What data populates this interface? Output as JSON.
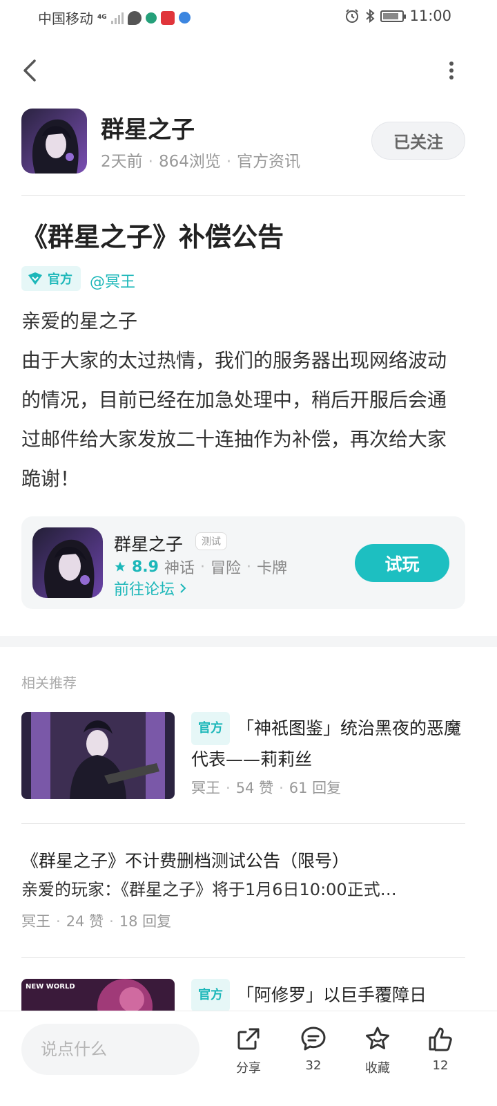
{
  "status_bar": {
    "carrier": "中国移动",
    "network": "4G",
    "time": "11:00"
  },
  "author": {
    "name": "群星之子",
    "time": "2天前",
    "views": "864浏览",
    "category": "官方资讯",
    "follow_label": "已关注"
  },
  "post": {
    "title": "《群星之子》补偿公告",
    "official_tag": "官方",
    "mention": "@冥王",
    "greeting": "亲爱的星之子",
    "body": "由于大家的太过热情，我们的服务器出现网络波动的情况，目前已经在加急处理中，稍后开服后会通过邮件给大家发放二十连抽作为补偿，再次给大家跪谢！"
  },
  "game_card": {
    "name": "群星之子",
    "badge": "测试",
    "score": "8.9",
    "tags": [
      "神话",
      "冒险",
      "卡牌"
    ],
    "forum_link": "前往论坛",
    "play_label": "试玩"
  },
  "related": {
    "section_title": "相关推荐",
    "items": [
      {
        "tag": "官方",
        "title": "「神祇图鉴」统治黑夜的恶魔代表——莉莉丝",
        "author": "冥王",
        "likes": "54 赞",
        "replies": "61 回复"
      },
      {
        "title": "《群星之子》不计费删档测试公告（限号）",
        "summary": "亲爱的玩家：《群星之子》将于1月6日10:00正式…",
        "author": "冥王",
        "likes": "24 赞",
        "replies": "18 回复"
      },
      {
        "tag": "官方",
        "title": "「阿修罗」以巨手覆障日",
        "thumb_text": "NEW WORLD"
      }
    ]
  },
  "bottom_bar": {
    "input_placeholder": "说点什么",
    "share_label": "分享",
    "comment_count": "32",
    "favorite_label": "收藏",
    "like_count": "12"
  },
  "colors": {
    "accent": "#1cb7b9",
    "play_button": "#1dbfc1"
  }
}
